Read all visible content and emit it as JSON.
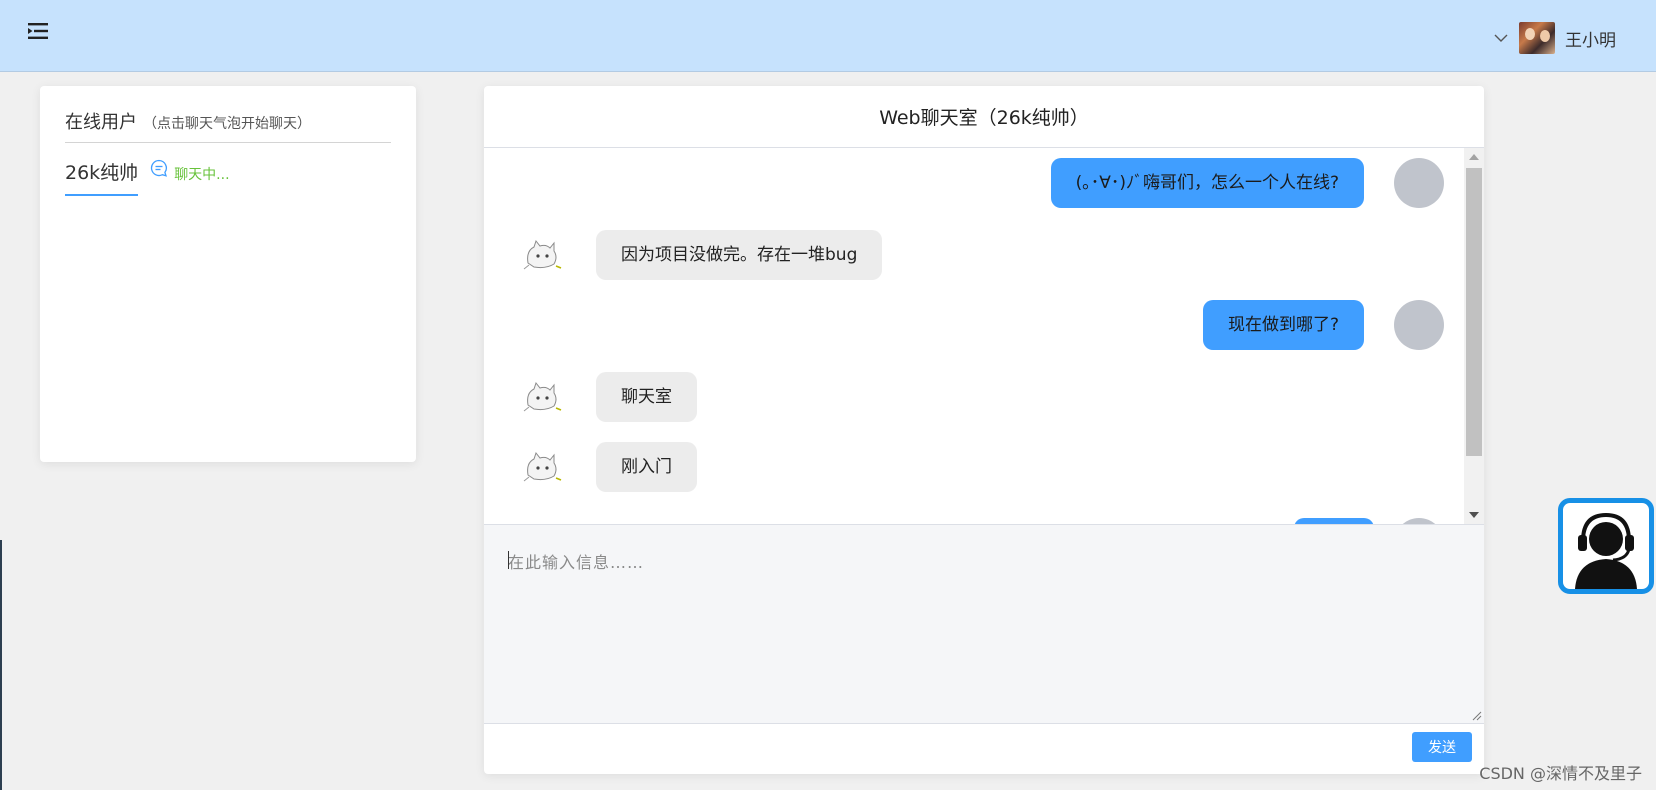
{
  "header": {
    "menu_icon": "menu-fold-icon",
    "username": "王小明"
  },
  "online_panel": {
    "title": "在线用户",
    "hint": "（点击聊天气泡开始聊天）",
    "users": [
      {
        "name": "26k纯帅",
        "status": "聊天中..."
      }
    ]
  },
  "chat": {
    "title": "Web聊天室（26k纯帅）",
    "messages": [
      {
        "side": "right",
        "text": "(｡･∀･)ﾉﾞ嗨哥们，怎么一个人在线?"
      },
      {
        "side": "left",
        "text": "因为项目没做完。存在一堆bug"
      },
      {
        "side": "right",
        "text": "现在做到哪了?"
      },
      {
        "side": "left",
        "text": "聊天室"
      },
      {
        "side": "left",
        "text": "刚入门"
      }
    ],
    "input_placeholder": "在此输入信息……",
    "send_label": "发送"
  },
  "colors": {
    "header_bg": "#c6e2fd",
    "accent": "#409eff",
    "status_green": "#67c23a",
    "support_border": "#1790e6"
  },
  "watermark": "CSDN @深情不及里子"
}
